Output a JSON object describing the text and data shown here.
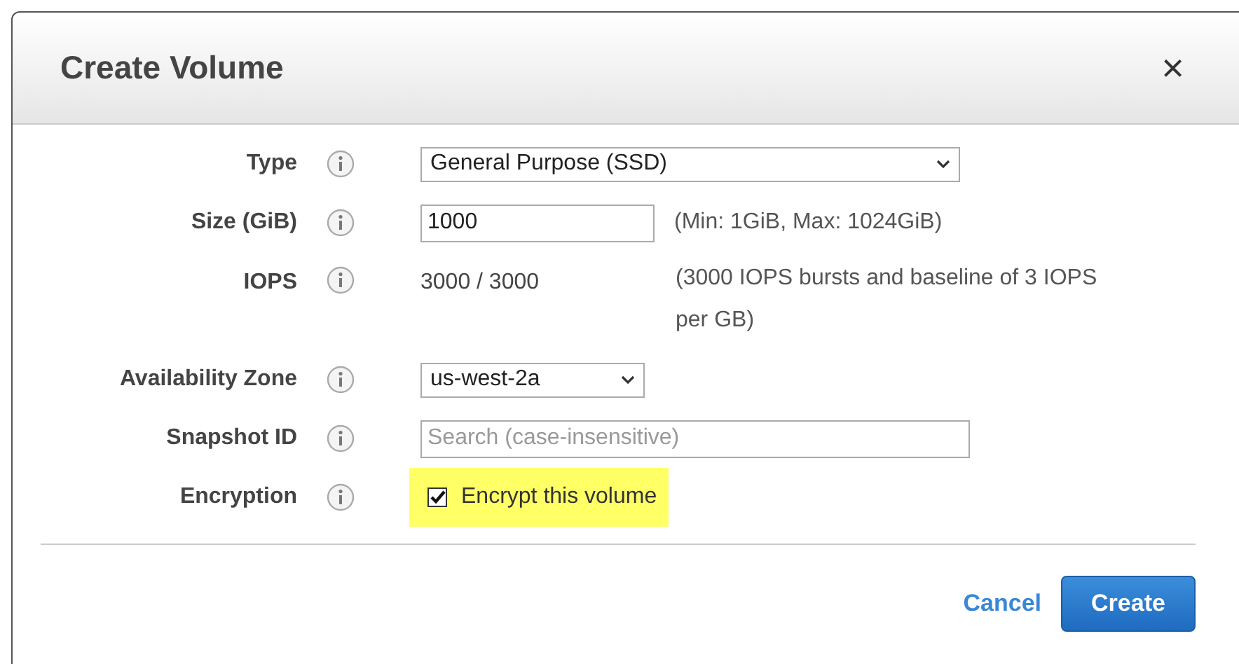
{
  "dialog": {
    "title": "Create Volume",
    "close": "×"
  },
  "fields": [
    {
      "label": "Type",
      "kind": "select",
      "value": "General Purpose (SSD)"
    },
    {
      "label": "Size (GiB)",
      "kind": "input",
      "value": "1000",
      "hint": "(Min: 1GiB, Max: 1024GiB)"
    },
    {
      "label": "IOPS",
      "kind": "text",
      "value": "3000 / 3000",
      "hint": "(3000 IOPS bursts and baseline of 3 IOPS per GB)"
    },
    {
      "label": "Availability Zone",
      "kind": "select",
      "value": "us-west-2a"
    },
    {
      "label": "Snapshot ID",
      "kind": "input",
      "placeholder": "Search (case-insensitive)"
    },
    {
      "label": "Encryption",
      "kind": "checkbox",
      "text": "Encrypt this volume",
      "checked": true,
      "highlighted": true
    }
  ],
  "buttons": {
    "cancel": "Cancel",
    "create": "Create"
  }
}
